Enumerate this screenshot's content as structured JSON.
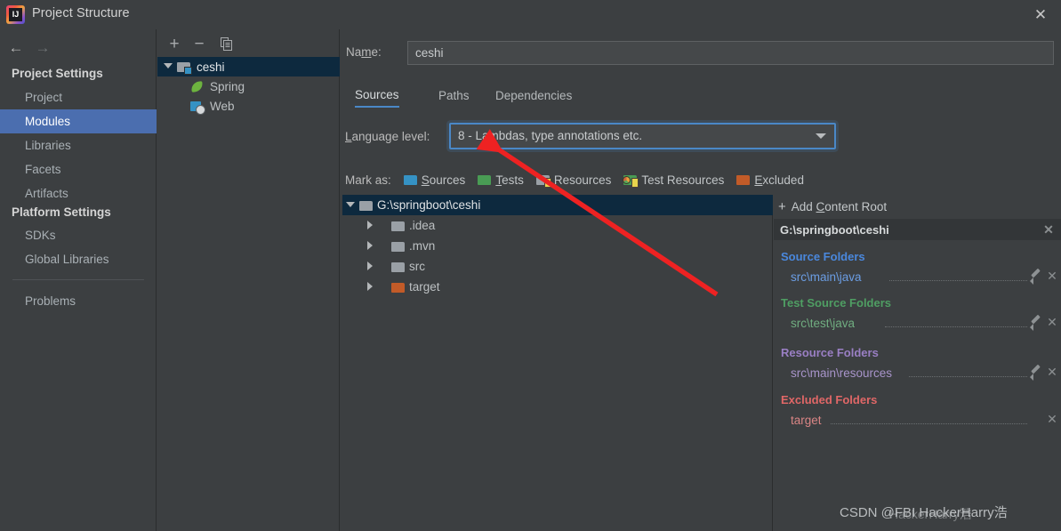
{
  "window": {
    "title": "Project Structure",
    "logo_icon": "intellij-idea-logo",
    "close_icon": "close-icon"
  },
  "nav": {
    "back_icon": "arrow-left-icon",
    "forward_icon": "arrow-right-icon"
  },
  "sidebar": {
    "groups": [
      {
        "label": "Project Settings"
      },
      {
        "label": "Platform Settings"
      }
    ],
    "items": [
      {
        "label": "Project",
        "selected": false
      },
      {
        "label": "Modules",
        "selected": true
      },
      {
        "label": "Libraries",
        "selected": false
      },
      {
        "label": "Facets",
        "selected": false
      },
      {
        "label": "Artifacts",
        "selected": false
      },
      {
        "label": "SDKs",
        "selected": false
      },
      {
        "label": "Global Libraries",
        "selected": false
      },
      {
        "label": "Problems",
        "selected": false
      }
    ]
  },
  "modules_panel": {
    "toolbar": {
      "add_label": "+",
      "remove_label": "–",
      "copy_icon": "copy-icon"
    },
    "tree": [
      {
        "label": "ceshi",
        "icon": "module-icon",
        "selected": true,
        "expanded": true
      },
      {
        "label": "Spring",
        "icon": "spring-leaf-icon",
        "selected": false
      },
      {
        "label": "Web",
        "icon": "web-icon",
        "selected": false
      }
    ]
  },
  "main": {
    "name_label": "Name:",
    "name_value": "ceshi",
    "tabs": [
      {
        "label": "Sources",
        "active": true
      },
      {
        "label": "Paths",
        "active": false
      },
      {
        "label": "Dependencies",
        "active": false
      }
    ],
    "language_level_label": "Language level:",
    "language_level_value": "8 - Lambdas, type annotations etc.",
    "mark_as_label": "Mark as:",
    "mark_as_buttons": [
      {
        "label": "Sources",
        "icon": "folder-sources-icon"
      },
      {
        "label": "Tests",
        "icon": "folder-tests-icon"
      },
      {
        "label": "Resources",
        "icon": "folder-resources-icon"
      },
      {
        "label": "Test Resources",
        "icon": "folder-test-resources-icon"
      },
      {
        "label": "Excluded",
        "icon": "folder-excluded-icon"
      }
    ],
    "content_tree": [
      {
        "label": "G:\\springboot\\ceshi",
        "icon": "folder-icon",
        "expanded": true,
        "selected": true
      },
      {
        "label": ".idea",
        "icon": "folder-icon",
        "expanded": false,
        "selected": false
      },
      {
        "label": ".mvn",
        "icon": "folder-icon",
        "expanded": false,
        "selected": false
      },
      {
        "label": "src",
        "icon": "folder-icon",
        "expanded": false,
        "selected": false
      },
      {
        "label": "target",
        "icon": "folder-excluded-icon",
        "expanded": false,
        "selected": false
      }
    ]
  },
  "right_panel": {
    "add_content_root_label": "Add Content Root",
    "content_root": "G:\\springboot\\ceshi",
    "groups": [
      {
        "title": "Source Folders",
        "color": "#4a88dd",
        "item_color": "#6b9de3",
        "items": [
          {
            "path": "src\\main\\java",
            "has_edit": true,
            "has_remove": true
          }
        ]
      },
      {
        "title": "Test Source Folders",
        "color": "#4f9e63",
        "item_color": "#70ad80",
        "items": [
          {
            "path": "src\\test\\java",
            "has_edit": true,
            "has_remove": true
          }
        ]
      },
      {
        "title": "Resource Folders",
        "color": "#9a7fc4",
        "item_color": "#a894ca",
        "items": [
          {
            "path": "src\\main\\resources",
            "has_edit": true,
            "has_remove": true
          }
        ]
      },
      {
        "title": "Excluded Folders",
        "color": "#e06767",
        "item_color": "#d98585",
        "items": [
          {
            "path": "target",
            "has_edit": false,
            "has_remove": true
          }
        ]
      }
    ]
  },
  "annotation": {
    "arrow_color": "#ee2222"
  },
  "watermark": {
    "text": "CSDN @FBI HackerHarry浩",
    "ghost_text": "HackerHarry浩"
  }
}
